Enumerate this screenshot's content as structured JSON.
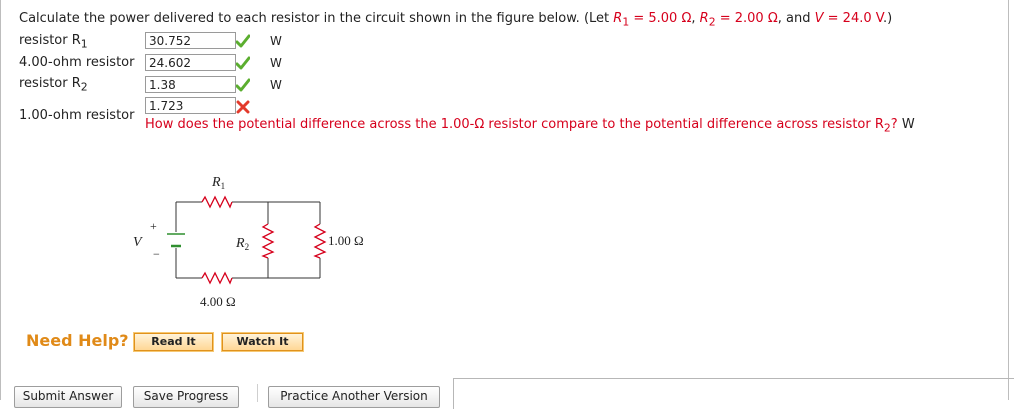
{
  "question": {
    "prefix": "Calculate the power delivered to each resistor in the circuit shown in the figure below. (Let ",
    "r1_var": "R",
    "r1_sub": "1",
    "r1_val": " = 5.00 Ω",
    "sep1": ", ",
    "r2_var": "R",
    "r2_sub": "2",
    "r2_val": " = 2.00 Ω",
    "sep2": ", and ",
    "v_var": "V",
    "v_val": " = 24.0 V",
    "suffix": ".)"
  },
  "rows": [
    {
      "label": "resistor R",
      "label_sub": "1",
      "value": "30.752",
      "status": "correct",
      "unit": "W"
    },
    {
      "label": "4.00-ohm resistor",
      "label_sub": "",
      "value": "24.602",
      "status": "correct",
      "unit": "W"
    },
    {
      "label": "resistor R",
      "label_sub": "2",
      "value": "1.38",
      "status": "correct",
      "unit": "W"
    },
    {
      "label": "1.00-ohm resistor",
      "label_sub": "",
      "value": "1.723",
      "status": "incorrect",
      "unit": ""
    }
  ],
  "feedback": {
    "text": "How does the potential difference across the 1.00-Ω resistor compare to the potential difference across resistor R",
    "sub": "2",
    "q": "?",
    "unit": "W"
  },
  "figure": {
    "r1_label": "R",
    "r1_sub": "1",
    "r2_label": "R",
    "r2_sub": "2",
    "r3_label": "1.00 Ω",
    "r4_label": "4.00 Ω",
    "v_label": "V",
    "plus": "+",
    "minus": "−"
  },
  "help": {
    "label": "Need Help?",
    "read_it": "Read It",
    "watch_it": "Watch It"
  },
  "actions": {
    "submit": "Submit Answer",
    "save": "Save Progress",
    "practice": "Practice Another Version"
  },
  "colors": {
    "accent_red": "#d6001c",
    "check_green": "#5bae2f",
    "help_orange": "#e08a18"
  }
}
